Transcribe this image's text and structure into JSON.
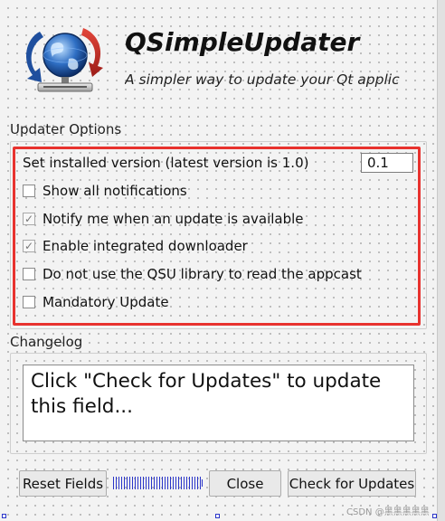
{
  "header": {
    "title": "QSimpleUpdater",
    "subtitle": "A simpler way to update your Qt applications",
    "logo_icon": "globe-update-icon"
  },
  "updater_options": {
    "label": "Updater Options",
    "version_label": "Set installed version (latest version is 1.0)",
    "version_value": "0.1",
    "checkboxes": [
      {
        "label": "Show all notifications",
        "checked": false
      },
      {
        "label": "Notify me when an update is available",
        "checked": true
      },
      {
        "label": "Enable integrated downloader",
        "checked": true
      },
      {
        "label": "Do not use the QSU library to read the appcast",
        "checked": false
      },
      {
        "label": "Mandatory Update",
        "checked": false
      }
    ]
  },
  "changelog": {
    "label": "Changelog",
    "text": "Click \"Check for Updates\" to update this field..."
  },
  "buttons": {
    "reset": "Reset Fields",
    "close": "Close",
    "check": "Check for Updates"
  },
  "watermark": "CSDN @黑黑黑黑黑",
  "colors": {
    "highlight_border": "#e8322e",
    "layout_handle": "#2a35c9"
  }
}
